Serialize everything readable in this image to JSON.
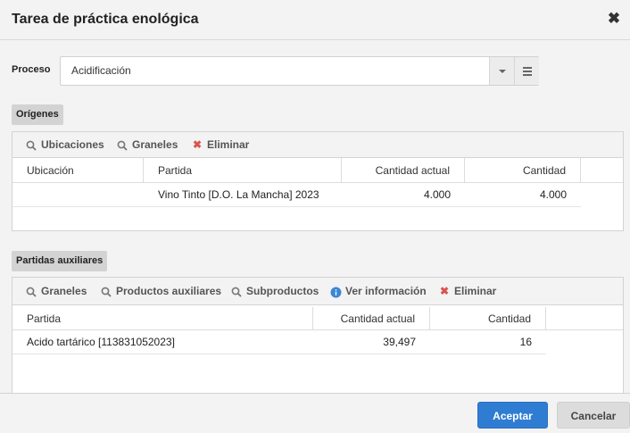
{
  "dialog": {
    "title": "Tarea de práctica enológica"
  },
  "process": {
    "label": "Proceso",
    "value": "Acidificación"
  },
  "origins": {
    "section_label": "Orígenes",
    "toolbar": {
      "locations": "Ubicaciones",
      "bulks": "Graneles",
      "delete": "Eliminar"
    },
    "columns": [
      "Ubicación",
      "Partida",
      "Cantidad actual",
      "Cantidad"
    ],
    "rows": [
      {
        "location": "",
        "batch": "Vino Tinto [D.O.  La Mancha] 2023",
        "current_qty": "4.000",
        "qty": "4.000"
      }
    ]
  },
  "auxiliary": {
    "section_label": "Partidas auxiliares",
    "toolbar": {
      "bulks": "Graneles",
      "aux_products": "Productos auxiliares",
      "byproducts": "Subproductos",
      "info": "Ver información",
      "delete": "Eliminar"
    },
    "columns": [
      "Partida",
      "Cantidad actual",
      "Cantidad"
    ],
    "rows": [
      {
        "batch": "Acido tartárico [113831052023]",
        "current_qty": "39,497",
        "qty": "16"
      }
    ]
  },
  "footer": {
    "accept": "Aceptar",
    "cancel": "Cancelar"
  },
  "colors": {
    "primary": "#2f7dd3",
    "delete": "#d9534f",
    "info": "#3a87d6"
  }
}
